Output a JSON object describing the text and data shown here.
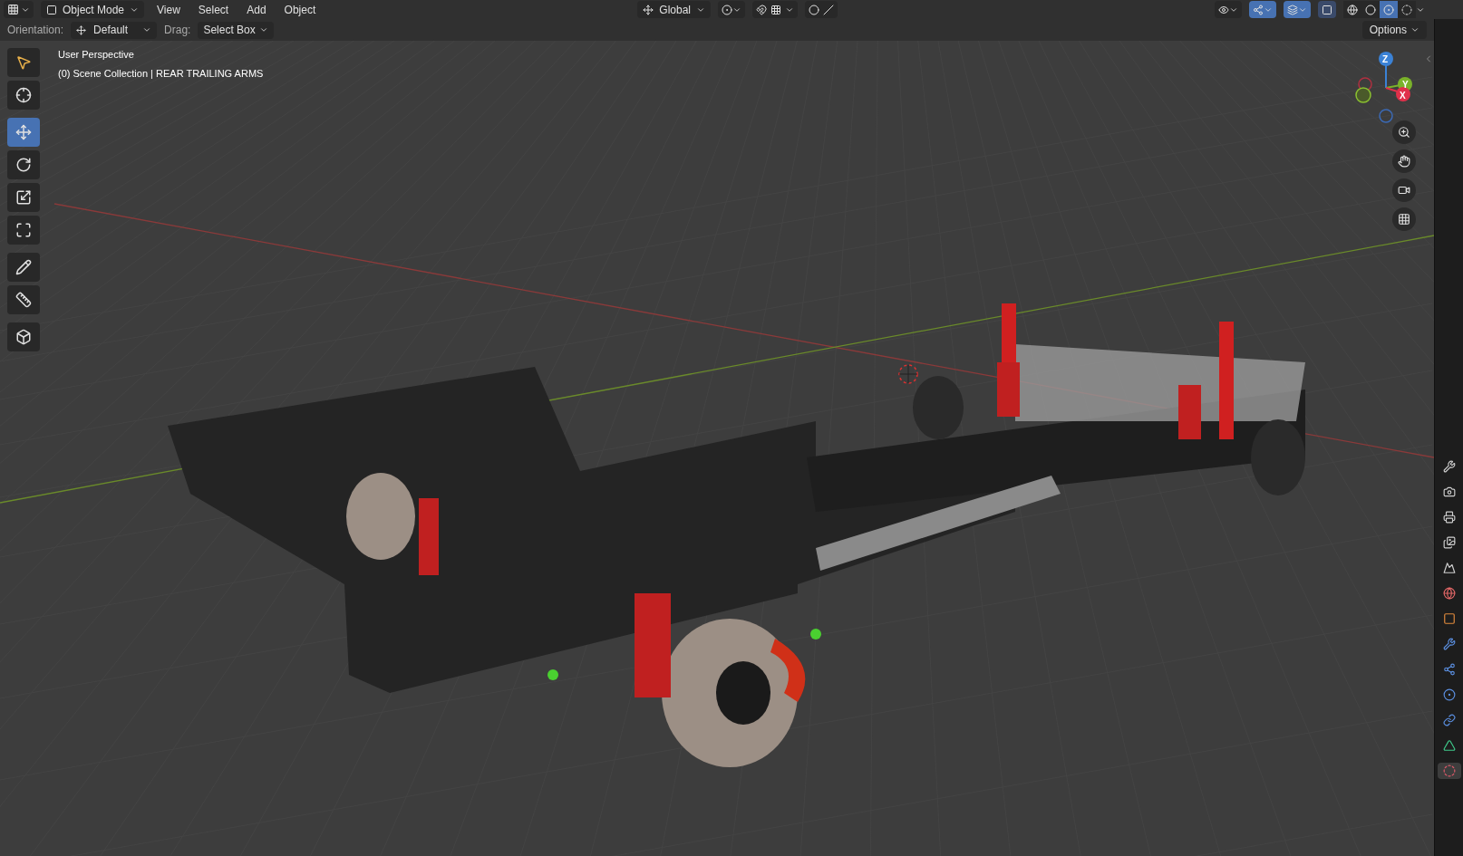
{
  "header": {
    "mode": "Object Mode",
    "menus": [
      "View",
      "Select",
      "Add",
      "Object"
    ],
    "transform": "Global",
    "shading": [
      {
        "kind": "wireframe",
        "selected": false
      },
      {
        "kind": "solid",
        "selected": false
      },
      {
        "kind": "material",
        "selected": true
      },
      {
        "kind": "rendered",
        "selected": false
      }
    ]
  },
  "tool_settings": {
    "orientation_label": "Orientation:",
    "orientation": "Default",
    "drag_label": "Drag:",
    "drag": "Select Box",
    "options": "Options"
  },
  "overlay": {
    "view_name": "User Perspective",
    "collection": "(0) Scene Collection | REAR TRAILING ARMS"
  },
  "toolbar": [
    {
      "kind": "select",
      "selected": false
    },
    {
      "kind": "cursor",
      "selected": false
    },
    {
      "kind": "move",
      "selected": true
    },
    {
      "kind": "rotate",
      "selected": false
    },
    {
      "kind": "scale",
      "selected": false
    },
    {
      "kind": "transform",
      "selected": false
    },
    {
      "kind": "annotate",
      "selected": false
    },
    {
      "kind": "measure",
      "selected": false
    },
    {
      "kind": "add-cube",
      "selected": false
    }
  ],
  "gizmo": {
    "z": "Z",
    "y": "Y",
    "x": "X"
  },
  "properties_tabs": [
    {
      "kind": "tool",
      "selected": false
    },
    {
      "kind": "render",
      "selected": false
    },
    {
      "kind": "output",
      "selected": false
    },
    {
      "kind": "view-layer",
      "selected": false
    },
    {
      "kind": "scene",
      "selected": false
    },
    {
      "kind": "world",
      "selected": false
    },
    {
      "kind": "object",
      "selected": false
    },
    {
      "kind": "modifiers",
      "selected": false
    },
    {
      "kind": "particles",
      "selected": false
    },
    {
      "kind": "physics",
      "selected": false
    },
    {
      "kind": "constraints",
      "selected": false
    },
    {
      "kind": "data",
      "selected": false
    },
    {
      "kind": "material",
      "selected": true
    }
  ]
}
